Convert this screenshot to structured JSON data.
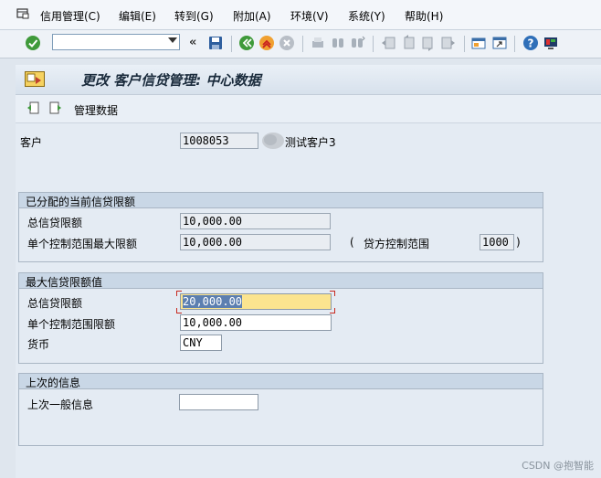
{
  "menu": {
    "items": [
      "信用管理(C)",
      "编辑(E)",
      "转到(G)",
      "附加(A)",
      "环境(V)",
      "系统(Y)",
      "帮助(H)"
    ]
  },
  "toolbar": {
    "command_value": "",
    "icons": [
      "enter-check-icon",
      "save-icon",
      "back-icon",
      "exit-icon",
      "cancel-icon",
      "print-icon",
      "find-icon",
      "find-next-icon",
      "first-page-icon",
      "prev-page-icon",
      "next-page-icon",
      "last-page-icon",
      "new-session-icon",
      "shortcut-icon",
      "help-icon",
      "layout-icon"
    ]
  },
  "title": "更改 客户信贷管理: 中心数据",
  "app_toolbar": {
    "button_label": "管理数据"
  },
  "customer": {
    "label": "客户",
    "number": "1008053",
    "name": "测试客户3"
  },
  "group_current": {
    "title": "已分配的当前信贷限额",
    "total_label": "总信贷限额",
    "total_value": "10,000.00",
    "single_label": "单个控制范围最大限额",
    "single_value": "10,000.00",
    "area_open": "(",
    "area_label": "贷方控制范围",
    "area_value": "1000",
    "area_close": ")"
  },
  "group_max": {
    "title": "最大信贷限额值",
    "total_label": "总信贷限额",
    "total_value": "20,000.00",
    "single_label": "单个控制范围限额",
    "single_value": "10,000.00",
    "currency_label": "货币",
    "currency_value": "CNY"
  },
  "group_last": {
    "title": "上次的信息",
    "general_label": "上次一般信息",
    "general_value": ""
  },
  "watermark": "CSDN @抱智能",
  "colors": {
    "focus_bg": "#fbe48f",
    "group_header": "#c9d7e6",
    "background": "#dfe6ee"
  }
}
